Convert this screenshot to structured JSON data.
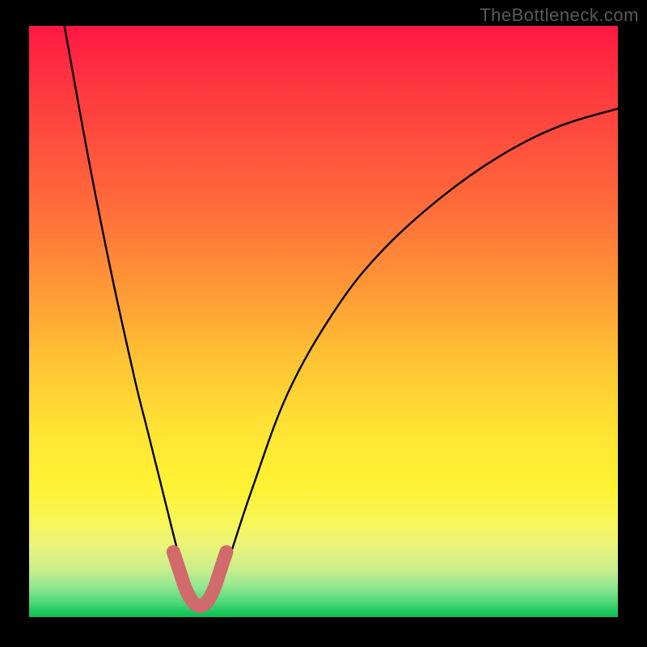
{
  "watermark": "TheBottleneck.com",
  "chart_data": {
    "type": "line",
    "title": "",
    "xlabel": "",
    "ylabel": "",
    "xlim": [
      0,
      100
    ],
    "ylim": [
      0,
      100
    ],
    "series": [
      {
        "name": "bottleneck-curve",
        "x": [
          6,
          10,
          14,
          18,
          20,
          22,
          24,
          26,
          27,
          28,
          29,
          30,
          31,
          32,
          34,
          38,
          44,
          52,
          60,
          70,
          80,
          90,
          100
        ],
        "y": [
          100,
          78,
          58,
          40,
          32,
          24,
          16,
          8,
          4,
          2,
          1.5,
          1.5,
          2,
          4,
          10,
          22,
          38,
          52,
          62,
          71,
          78,
          83,
          86
        ]
      },
      {
        "name": "highlight-band",
        "x": [
          24.5,
          25.5,
          26.5,
          27.5,
          28.5,
          29.5,
          30.5,
          31.5,
          32.5,
          33.5
        ],
        "y": [
          11,
          8,
          5,
          3,
          2,
          2,
          3,
          5,
          8,
          11
        ]
      }
    ],
    "background_gradient": {
      "top": "#ff1844",
      "mid": "#ffe733",
      "bottom": "#0fbf55"
    },
    "highlight_color": "#d16a6a"
  }
}
